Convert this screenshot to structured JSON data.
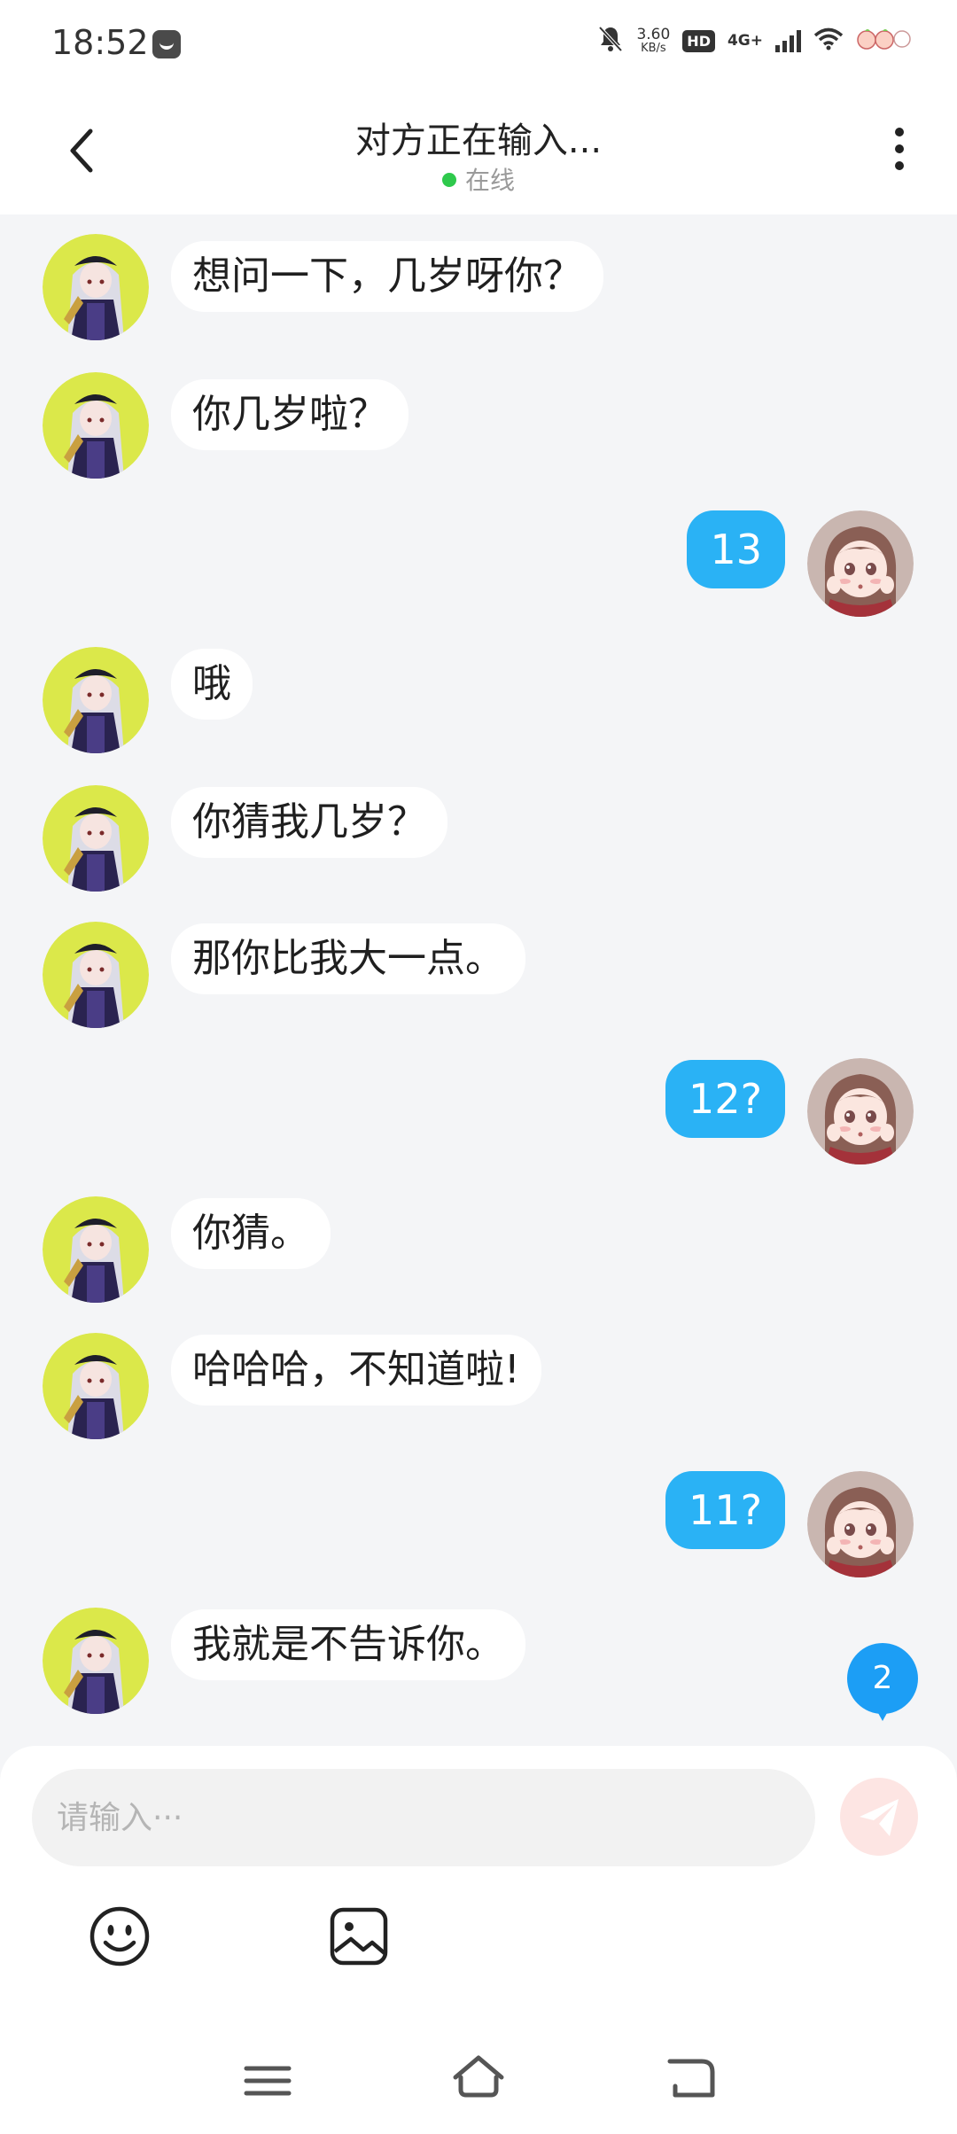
{
  "status_bar": {
    "time": "18:52",
    "net_speed_value": "3.60",
    "net_speed_unit": "KB/s",
    "hd_label": "HD",
    "signal_label": "4G+"
  },
  "header": {
    "title": "对方正在输入...",
    "status": "在线",
    "online_color": "#2ec94c"
  },
  "messages": [
    {
      "side": "in",
      "text": "想问一下，几岁呀你？"
    },
    {
      "side": "in",
      "text": "你几岁啦？"
    },
    {
      "side": "out",
      "text": "13"
    },
    {
      "side": "in",
      "text": "哦"
    },
    {
      "side": "in",
      "text": "你猜我几岁？"
    },
    {
      "side": "in",
      "text": "那你比我大一点。"
    },
    {
      "side": "out",
      "text": "12?"
    },
    {
      "side": "in",
      "text": "你猜。"
    },
    {
      "side": "in",
      "text": "哈哈哈，不知道啦!"
    },
    {
      "side": "out",
      "text": "11?"
    },
    {
      "side": "in",
      "text": "我就是不告诉你。"
    }
  ],
  "unread_badge": "2",
  "composer": {
    "placeholder": "请输入···",
    "send_icon": "send-icon",
    "emoji_icon": "emoji-icon",
    "image_icon": "image-icon"
  },
  "colors": {
    "outgoing_bubble": "#2ab2f5",
    "incoming_bubble": "#ffffff",
    "badge": "#1c9ef5",
    "background": "#f4f5f7"
  }
}
